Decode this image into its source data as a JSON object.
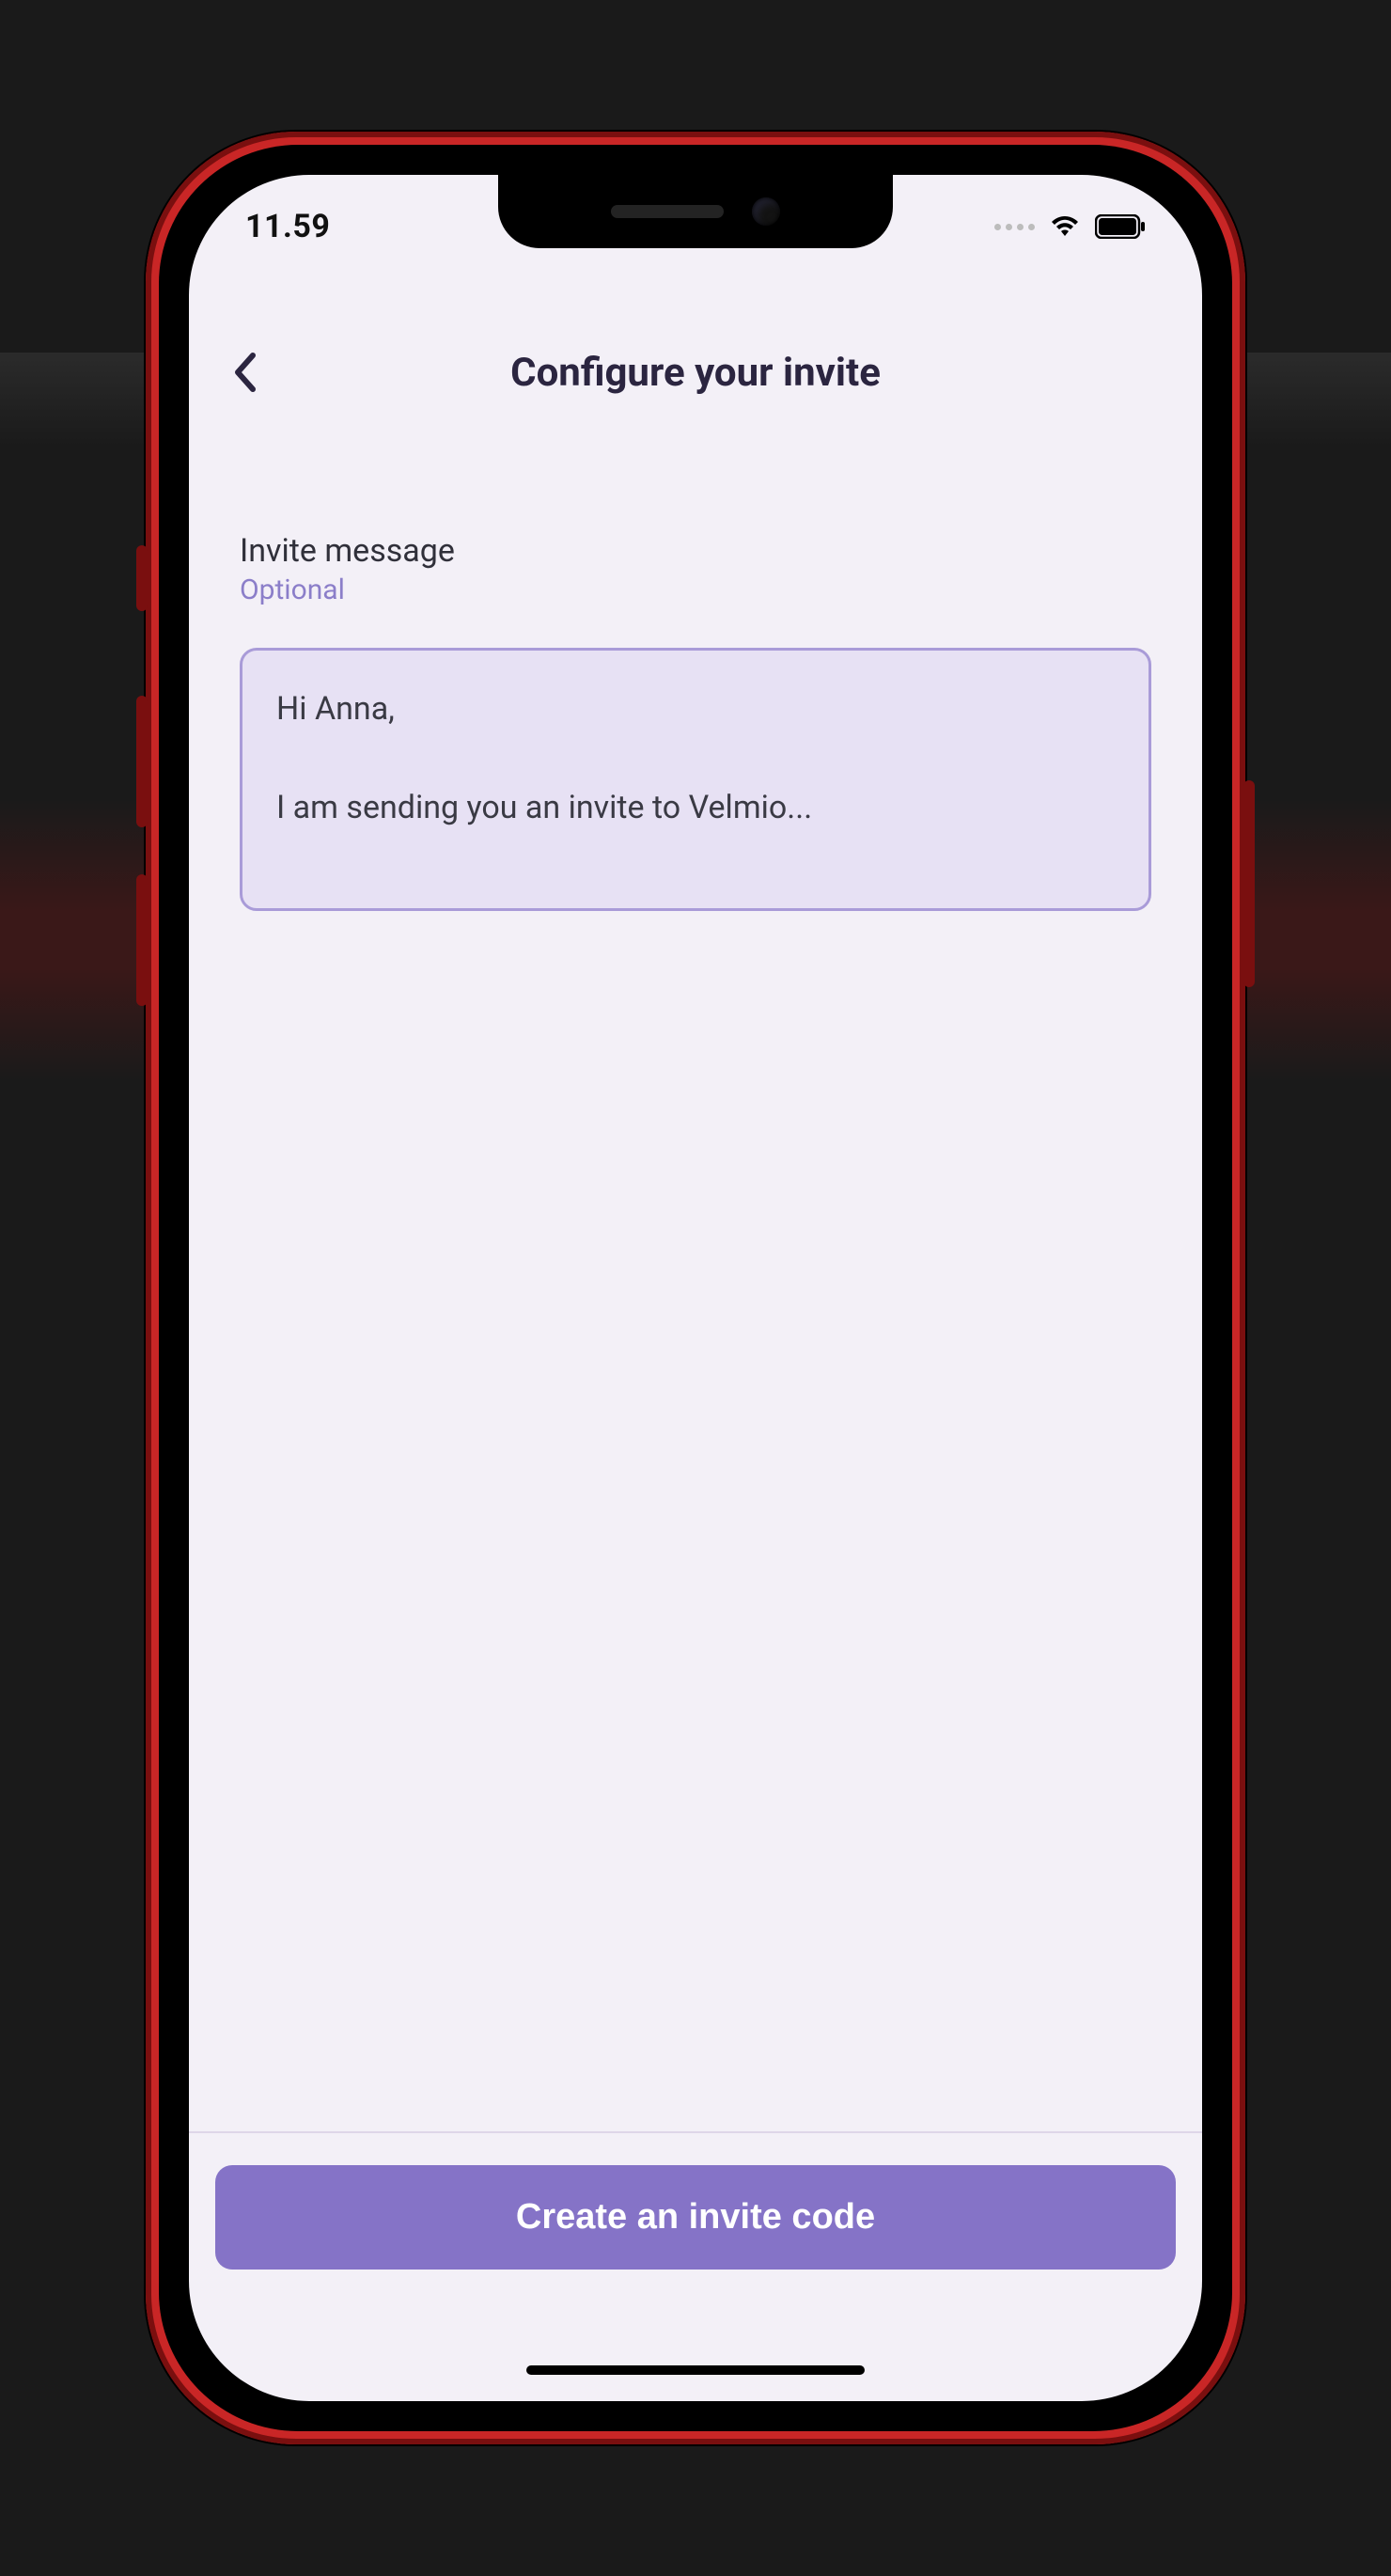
{
  "status_bar": {
    "time": "11.59"
  },
  "header": {
    "title": "Configure your invite"
  },
  "form": {
    "invite_message": {
      "label": "Invite message",
      "sublabel": "Optional",
      "value": "Hi Anna,\n\nI am sending you an invite to Velmio..."
    }
  },
  "footer": {
    "create_button_label": "Create an invite code"
  },
  "colors": {
    "accent": "#8573c7",
    "field_border": "#a99bd8",
    "field_bg": "#e7e1f4",
    "screen_bg": "#f3f0f7"
  }
}
